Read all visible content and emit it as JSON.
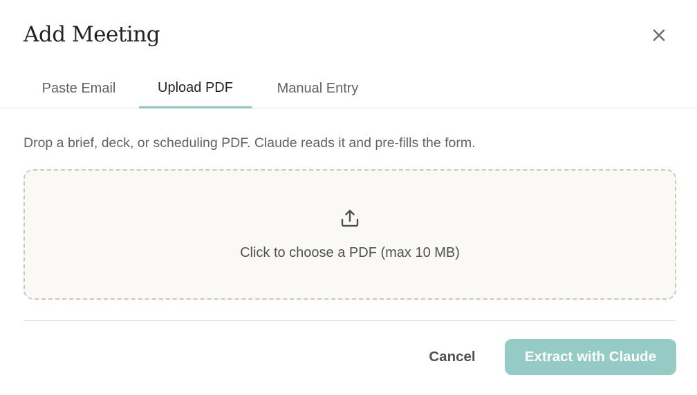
{
  "dialog": {
    "title": "Add Meeting",
    "close_icon": "close-icon"
  },
  "tabs": [
    {
      "label": "Paste Email",
      "active": false
    },
    {
      "label": "Upload PDF",
      "active": true
    },
    {
      "label": "Manual Entry",
      "active": false
    }
  ],
  "upload": {
    "description": "Drop a brief, deck, or scheduling PDF. Claude reads it and pre-fills the form.",
    "dropzone_icon": "upload-icon",
    "dropzone_label": "Click to choose a PDF (max 10 MB)"
  },
  "footer": {
    "cancel_label": "Cancel",
    "extract_label": "Extract with Claude"
  },
  "colors": {
    "accent": "#8cc7c0",
    "primary_button": "#94cbc4",
    "dropzone_background": "#faf9f5",
    "dropzone_border": "#cfc7b6"
  }
}
